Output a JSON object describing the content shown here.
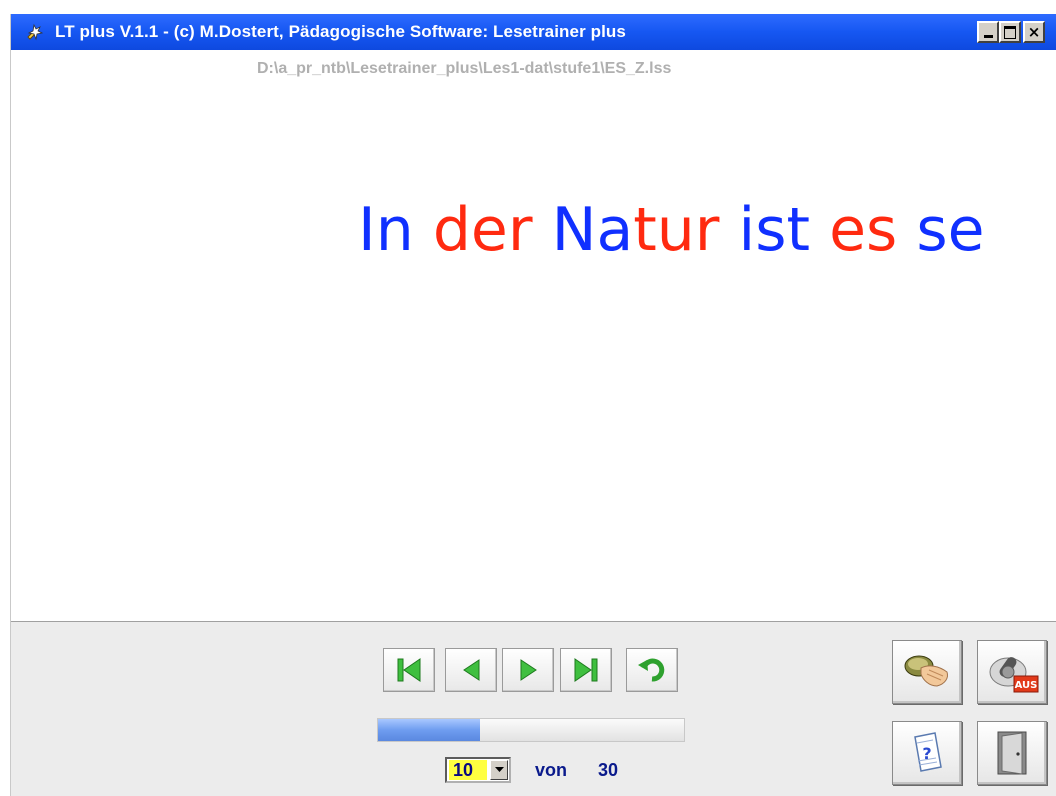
{
  "window": {
    "title": "LT plus   V.1.1 - (c) M.Dostert, Pädagogische Software: Lesetrainer plus",
    "controls": [
      "minimize",
      "maximize",
      "close"
    ]
  },
  "file_path": "D:\\a_pr_ntb\\Lesetrainer_plus\\Les1-dat\\stufe1\\ES_Z.lss",
  "sentence": {
    "segments": [
      {
        "text": "In",
        "color": "#1030ff"
      },
      {
        "text": " ",
        "color": "#1030ff"
      },
      {
        "text": "der",
        "color": "#ff2a10"
      },
      {
        "text": " ",
        "color": "#1030ff"
      },
      {
        "text": "Na",
        "color": "#1030ff"
      },
      {
        "text": "tur",
        "color": "#ff2a10"
      },
      {
        "text": " ",
        "color": "#1030ff"
      },
      {
        "text": "ist",
        "color": "#1030ff"
      },
      {
        "text": " ",
        "color": "#1030ff"
      },
      {
        "text": "es",
        "color": "#ff2a10"
      },
      {
        "text": " ",
        "color": "#1030ff"
      },
      {
        "text": "se",
        "color": "#1030ff"
      }
    ]
  },
  "navigation": {
    "buttons": [
      "first-icon",
      "previous-icon",
      "next-icon",
      "last-icon",
      "repeat-icon"
    ],
    "accent_color": "#3fbf3f"
  },
  "progress": {
    "fraction": 0.333
  },
  "pager": {
    "current": "10",
    "of_label": "von",
    "total": "30"
  },
  "tools": {
    "icons": [
      "hand-mouse-icon",
      "off-switch-icon",
      "help-document-icon",
      "exit-door-icon"
    ],
    "switch_label": "AUS"
  }
}
